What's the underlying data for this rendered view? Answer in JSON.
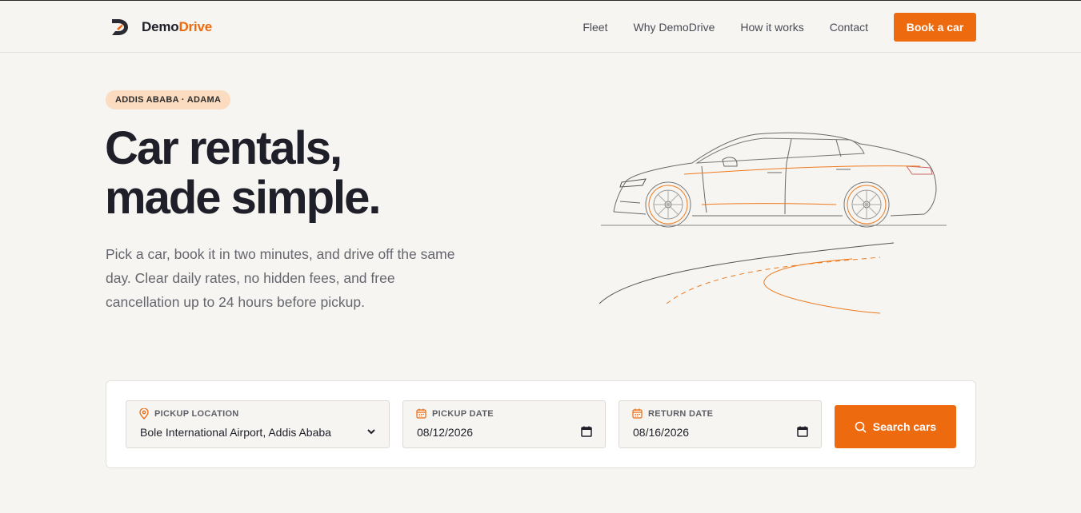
{
  "brand": {
    "name_part1": "Demo",
    "name_part2": "Drive",
    "accent_color": "#ee6a0f"
  },
  "nav": {
    "items": [
      "Fleet",
      "Why DemoDrive",
      "How it works",
      "Contact"
    ],
    "cta_label": "Book a car"
  },
  "hero": {
    "badge": "ADDIS ABABA · ADAMA",
    "title_line1": "Car rentals,",
    "title_line2": "made simple.",
    "subtitle": "Pick a car, book it in two minutes, and drive off the same day. Clear daily rates, no hidden fees, and free cancellation up to 24 hours before pickup."
  },
  "search": {
    "pickup_location": {
      "label": "PICKUP LOCATION",
      "value": "Bole International Airport, Addis Ababa",
      "icon": "map-pin-icon"
    },
    "pickup_date": {
      "label": "PICKUP DATE",
      "value": "08/12/2026",
      "icon": "calendar-icon"
    },
    "return_date": {
      "label": "RETURN DATE",
      "value": "08/16/2026",
      "icon": "calendar-icon"
    },
    "button_label": "Search cars"
  }
}
